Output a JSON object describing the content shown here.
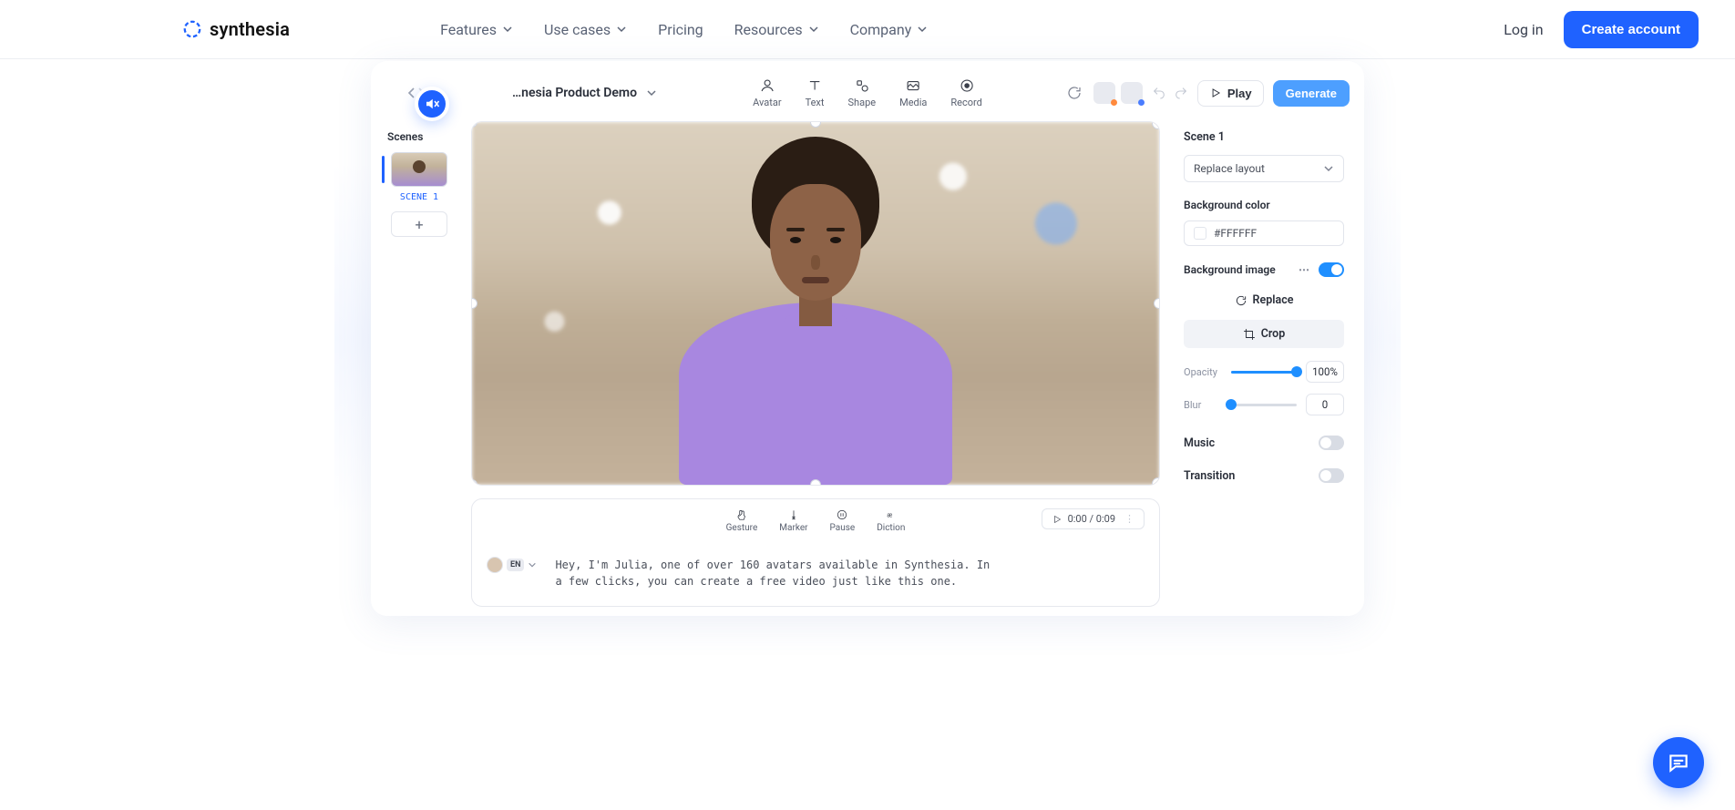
{
  "nav": {
    "brand": "synthesia",
    "links": [
      "Features",
      "Use cases",
      "Pricing",
      "Resources",
      "Company"
    ],
    "login": "Log in",
    "create": "Create account"
  },
  "app": {
    "project_title": "…nesia Product Demo",
    "toolbar": {
      "avatar": "Avatar",
      "text": "Text",
      "shape": "Shape",
      "media": "Media",
      "record": "Record"
    },
    "play": "Play",
    "generate": "Generate"
  },
  "scenes": {
    "title": "Scenes",
    "item_label": "SCENE 1"
  },
  "script": {
    "tools": {
      "gesture": "Gesture",
      "marker": "Marker",
      "pause": "Pause",
      "diction": "Diction"
    },
    "time": "0:00 / 0:09",
    "lang": "EN",
    "text": "Hey, I'm Julia, one of over 160 avatars available in Synthesia. In a few clicks, you can create a free video just like this one."
  },
  "props": {
    "title": "Scene 1",
    "layout_select": "Replace layout",
    "bg_color_label": "Background color",
    "bg_color_value": "#FFFFFF",
    "bg_image_label": "Background image",
    "replace": "Replace",
    "crop": "Crop",
    "opacity_label": "Opacity",
    "opacity_value": "100%",
    "opacity_pct": 100,
    "blur_label": "Blur",
    "blur_value": "0",
    "blur_pct": 0,
    "music_label": "Music",
    "transition_label": "Transition"
  }
}
